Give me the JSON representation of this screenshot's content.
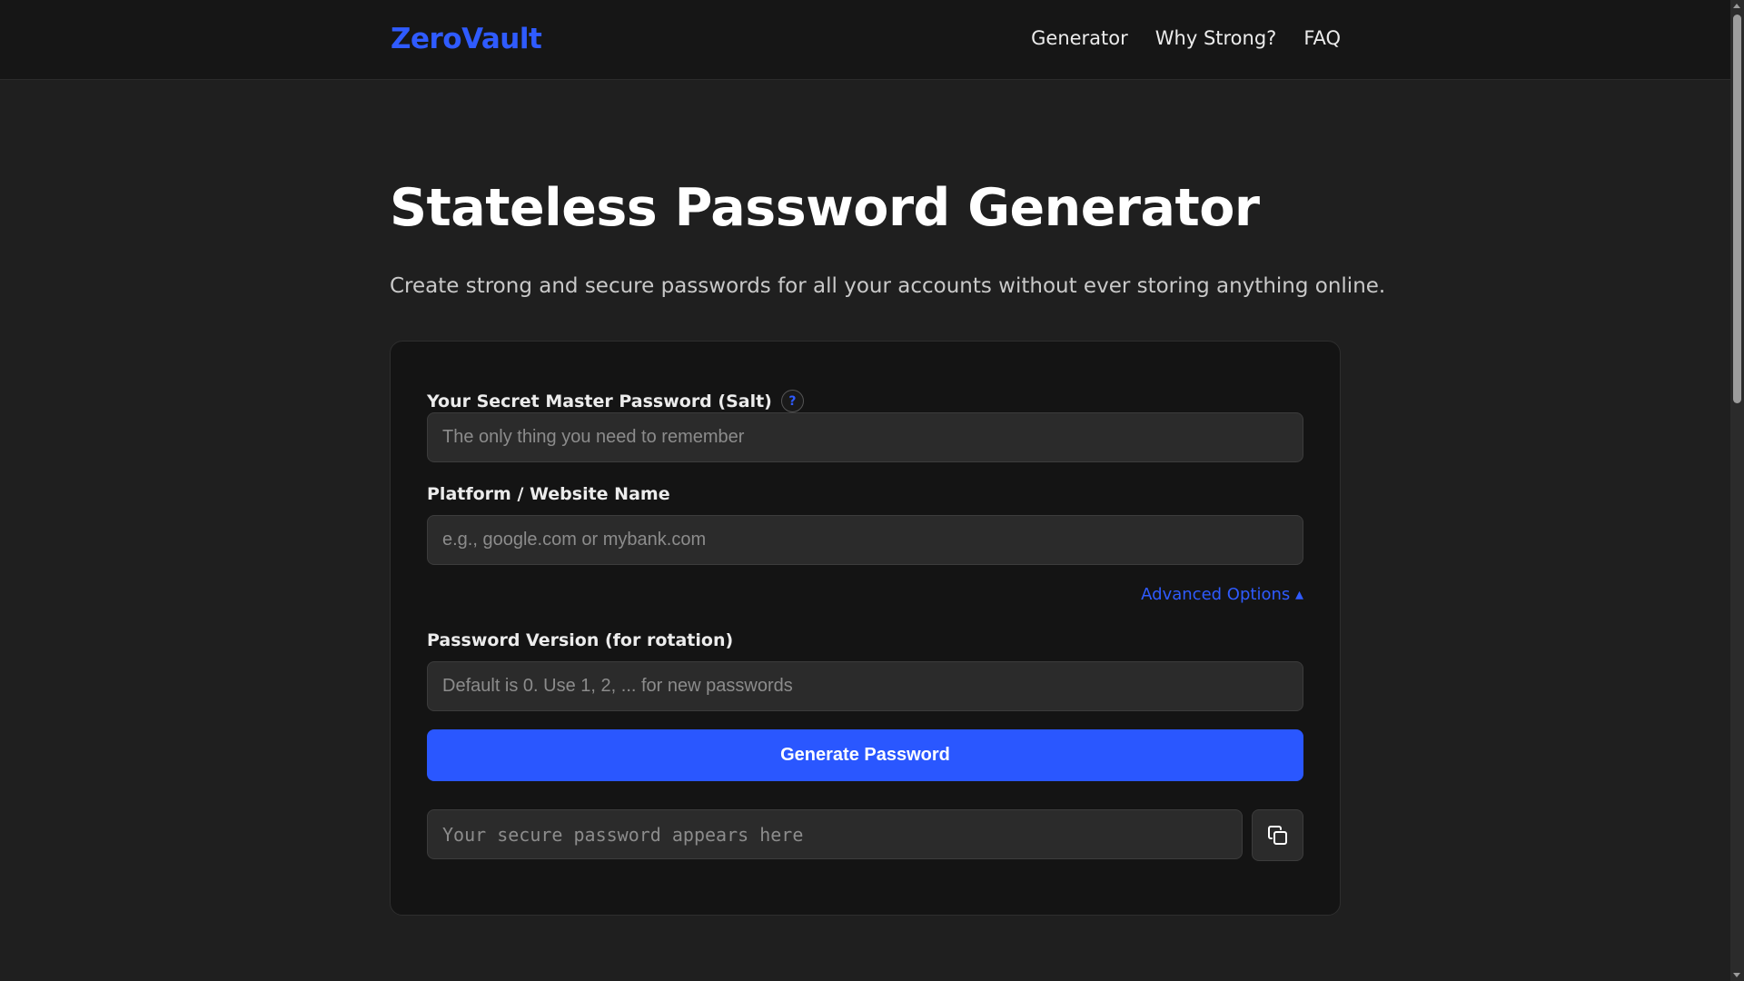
{
  "header": {
    "logo": "ZeroVault",
    "nav": [
      {
        "label": "Generator"
      },
      {
        "label": "Why Strong?"
      },
      {
        "label": "FAQ"
      }
    ]
  },
  "hero": {
    "title": "Stateless Password Generator",
    "subtitle": "Create strong and secure passwords for all your accounts without ever storing anything online."
  },
  "form": {
    "master": {
      "label": "Your Secret Master Password (Salt)",
      "help_icon": "?",
      "value": "",
      "placeholder": "The only thing you need to remember"
    },
    "platform": {
      "label": "Platform / Website Name",
      "value": "",
      "placeholder": "e.g., google.com or mybank.com"
    },
    "advanced_toggle": "Advanced Options ▴",
    "version": {
      "label": "Password Version (for rotation)",
      "value": "",
      "placeholder": "Default is 0. Use 1, 2, ... for new passwords"
    },
    "generate_label": "Generate Password",
    "output": {
      "value": "",
      "placeholder": "Your secure password appears here"
    },
    "copy_icon": "copy-icon"
  },
  "colors": {
    "accent": "#2a57ff",
    "background": "#1f1f1f",
    "card": "#141414",
    "header": "#161616"
  }
}
